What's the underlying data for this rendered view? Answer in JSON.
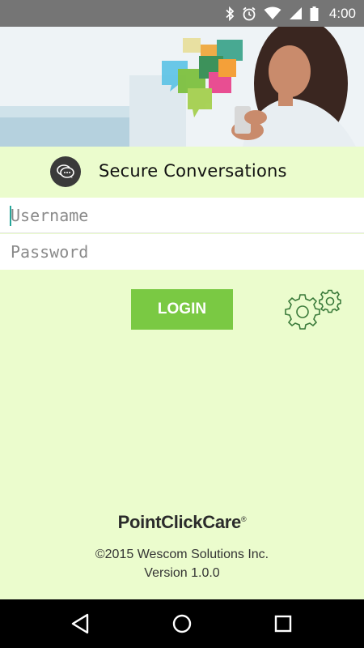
{
  "status_bar": {
    "time": "4:00",
    "icons": [
      "bluetooth-icon",
      "alarm-icon",
      "wifi-icon",
      "signal-icon",
      "battery-icon"
    ]
  },
  "header": {
    "title": "Secure Conversations",
    "badge_icon": "chat-bubbles-icon"
  },
  "form": {
    "username_placeholder": "Username",
    "password_placeholder": "Password",
    "username_value": "",
    "password_value": ""
  },
  "actions": {
    "login_label": "LOGIN",
    "settings_icon": "settings-gears-icon"
  },
  "footer": {
    "brand": "PointClickCare",
    "brand_mark": "®",
    "copyright": "©2015 Wescom Solutions Inc.",
    "version": "Version 1.0.0"
  },
  "colors": {
    "background": "#ebfccd",
    "accent": "#7ac943",
    "status_bar": "#757575",
    "nav_bar": "#000000"
  },
  "nav": {
    "back_icon": "back-triangle-icon",
    "home_icon": "home-circle-icon",
    "recents_icon": "recents-square-icon"
  }
}
